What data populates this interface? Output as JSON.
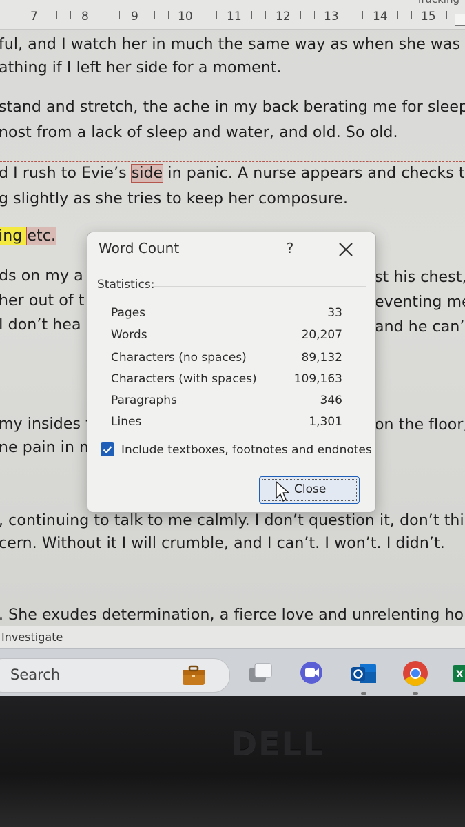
{
  "ruler": {
    "corner_text": "Tracking",
    "numbers": [
      "7",
      "8",
      "9",
      "10",
      "11",
      "12",
      "13",
      "14",
      "15"
    ]
  },
  "document": {
    "lines": {
      "l1": "ful, and I watch her in much the same way as when she was",
      "l2": "athing if I left her side for a moment.",
      "l3": "stand and stretch, the ache in my back berating me for sleeping",
      "l4": "nost from a lack of sleep and water, and old. So old.",
      "l5a": "d I rush to Evie’s ",
      "l5b": "side",
      "l5c": " in panic. A nurse appears and checks the",
      "l6": "g slightly as she tries to keep her composure.",
      "l7a": "ing ",
      "l7b": "etc.",
      "l8a": "ds on my a",
      "l8b": "st his chest,",
      "l9a": "her out of t",
      "l9b": "eventing me",
      "l10a": "I don’t hea",
      "l10b": "and he can’t.",
      "l11a": "my insides t",
      "l11b": "on the floor,",
      "l12a": "ne pain in m",
      "l13": ", continuing to talk to me calmly. I don’t question it, don’t think",
      "l14": "cern. Without it I will crumble, and I can’t. I won’t. I didn’t.",
      "l15": ". She exudes determination, a fierce love and unrelenting hope"
    }
  },
  "status_bar": {
    "text": "Investigate"
  },
  "taskbar": {
    "search_label": "Search",
    "icons": [
      "briefcase-icon",
      "task-view-icon",
      "video-chat-icon",
      "outlook-icon",
      "chrome-icon",
      "excel-icon"
    ]
  },
  "dialog": {
    "title": "Word Count",
    "help_label": "?",
    "section_label": "Statistics:",
    "stats": [
      {
        "label": "Pages",
        "value": "33"
      },
      {
        "label": "Words",
        "value": "20,207"
      },
      {
        "label": "Characters (no spaces)",
        "value": "89,132"
      },
      {
        "label": "Characters (with spaces)",
        "value": "109,163"
      },
      {
        "label": "Paragraphs",
        "value": "346"
      },
      {
        "label": "Lines",
        "value": "1,301"
      }
    ],
    "include_label": "Include textboxes, footnotes and endnotes",
    "include_checked": true,
    "close_label": "Close"
  },
  "bezel": {
    "logo": "DELL"
  },
  "colors": {
    "accent": "#1f5fb8",
    "highlight": "#f3e940",
    "tracked_change": "#b4564c"
  }
}
